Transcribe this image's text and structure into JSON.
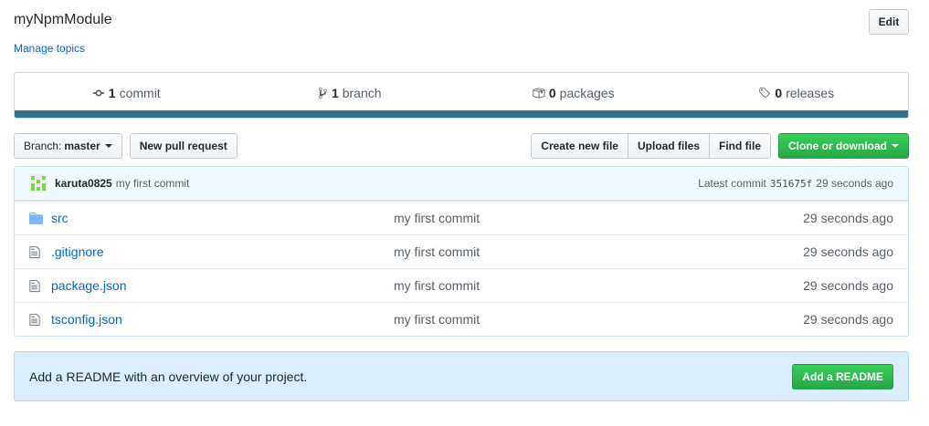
{
  "repo": {
    "name": "myNpmModule",
    "manage_topics": "Manage topics",
    "edit_label": "Edit"
  },
  "summary": {
    "commits": {
      "count": "1",
      "label": "commit"
    },
    "branches": {
      "count": "1",
      "label": "branch"
    },
    "packages": {
      "count": "0",
      "label": "packages"
    },
    "releases": {
      "count": "0",
      "label": "releases"
    },
    "language_color": "#2b7489"
  },
  "toolbar": {
    "branch_prefix": "Branch:",
    "branch_name": "master",
    "new_pull_request": "New pull request",
    "create_new_file": "Create new file",
    "upload_files": "Upload files",
    "find_file": "Find file",
    "clone_or_download": "Clone or download"
  },
  "latest_commit": {
    "author": "karuta0825",
    "message": "my first commit",
    "label": "Latest commit",
    "sha": "351675f",
    "age": "29 seconds ago"
  },
  "files": [
    {
      "name": "src",
      "type": "folder",
      "icon": "folder-icon",
      "message": "my first commit",
      "age": "29 seconds ago"
    },
    {
      "name": ".gitignore",
      "type": "file",
      "icon": "file-icon",
      "message": "my first commit",
      "age": "29 seconds ago"
    },
    {
      "name": "package.json",
      "type": "file",
      "icon": "file-icon",
      "message": "my first commit",
      "age": "29 seconds ago"
    },
    {
      "name": "tsconfig.json",
      "type": "file",
      "icon": "file-icon",
      "message": "my first commit",
      "age": "29 seconds ago"
    }
  ],
  "readme": {
    "prompt": "Add a README with an overview of your project.",
    "button": "Add a README"
  },
  "colors": {
    "link": "#0366d6",
    "green": "#28a745",
    "commit_bg": "#f1f8ff",
    "readme_bg": "#dbedff"
  }
}
